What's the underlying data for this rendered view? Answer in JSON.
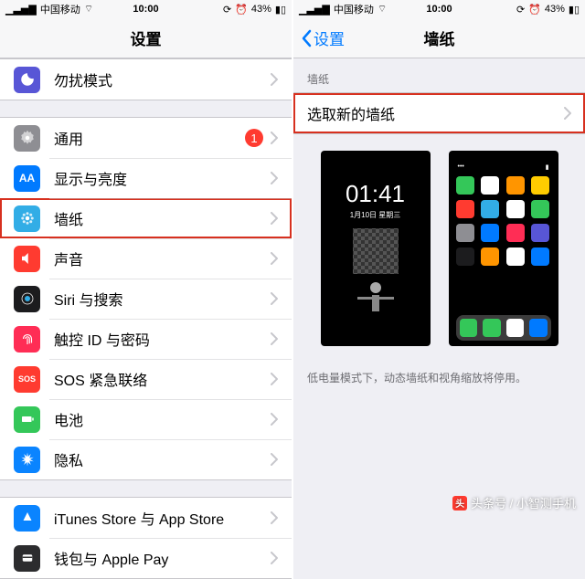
{
  "statusbar": {
    "carrier": "中国移动",
    "time": "10:00",
    "battery": "43%"
  },
  "left": {
    "title": "设置",
    "groups": [
      {
        "rows": [
          {
            "icon": "moon",
            "color": "ic-purple",
            "label": "勿扰模式"
          }
        ]
      },
      {
        "rows": [
          {
            "icon": "gear",
            "color": "ic-gray",
            "label": "通用",
            "badge": "1"
          },
          {
            "icon": "aa",
            "color": "ic-blue",
            "label": "显示与亮度"
          },
          {
            "icon": "flower",
            "color": "ic-cyan",
            "label": "墙纸",
            "highlight": true
          },
          {
            "icon": "speaker",
            "color": "ic-red",
            "label": "声音"
          },
          {
            "icon": "siri",
            "color": "ic-black",
            "label": "Siri 与搜索"
          },
          {
            "icon": "touchid",
            "color": "ic-pink",
            "label": "触控 ID 与密码"
          },
          {
            "icon": "sos",
            "color": "ic-sos",
            "label": "SOS 紧急联络"
          },
          {
            "icon": "battery",
            "color": "ic-green",
            "label": "电池"
          },
          {
            "icon": "hand",
            "color": "ic-bluea",
            "label": "隐私"
          }
        ]
      },
      {
        "rows": [
          {
            "icon": "appstore",
            "color": "ic-bluea",
            "label": "iTunes Store 与 App Store"
          },
          {
            "icon": "wallet",
            "color": "ic-dark",
            "label": "钱包与 Apple Pay"
          }
        ]
      }
    ]
  },
  "right": {
    "back": "设置",
    "title": "墙纸",
    "section_header": "墙纸",
    "choose_row": "选取新的墙纸",
    "lock_preview": {
      "time": "01:41",
      "date": "1月10日 星期三"
    },
    "note": "低电量模式下，动态墙纸和视角缩放将停用。"
  },
  "watermark": "头条号 / 小智测手机"
}
